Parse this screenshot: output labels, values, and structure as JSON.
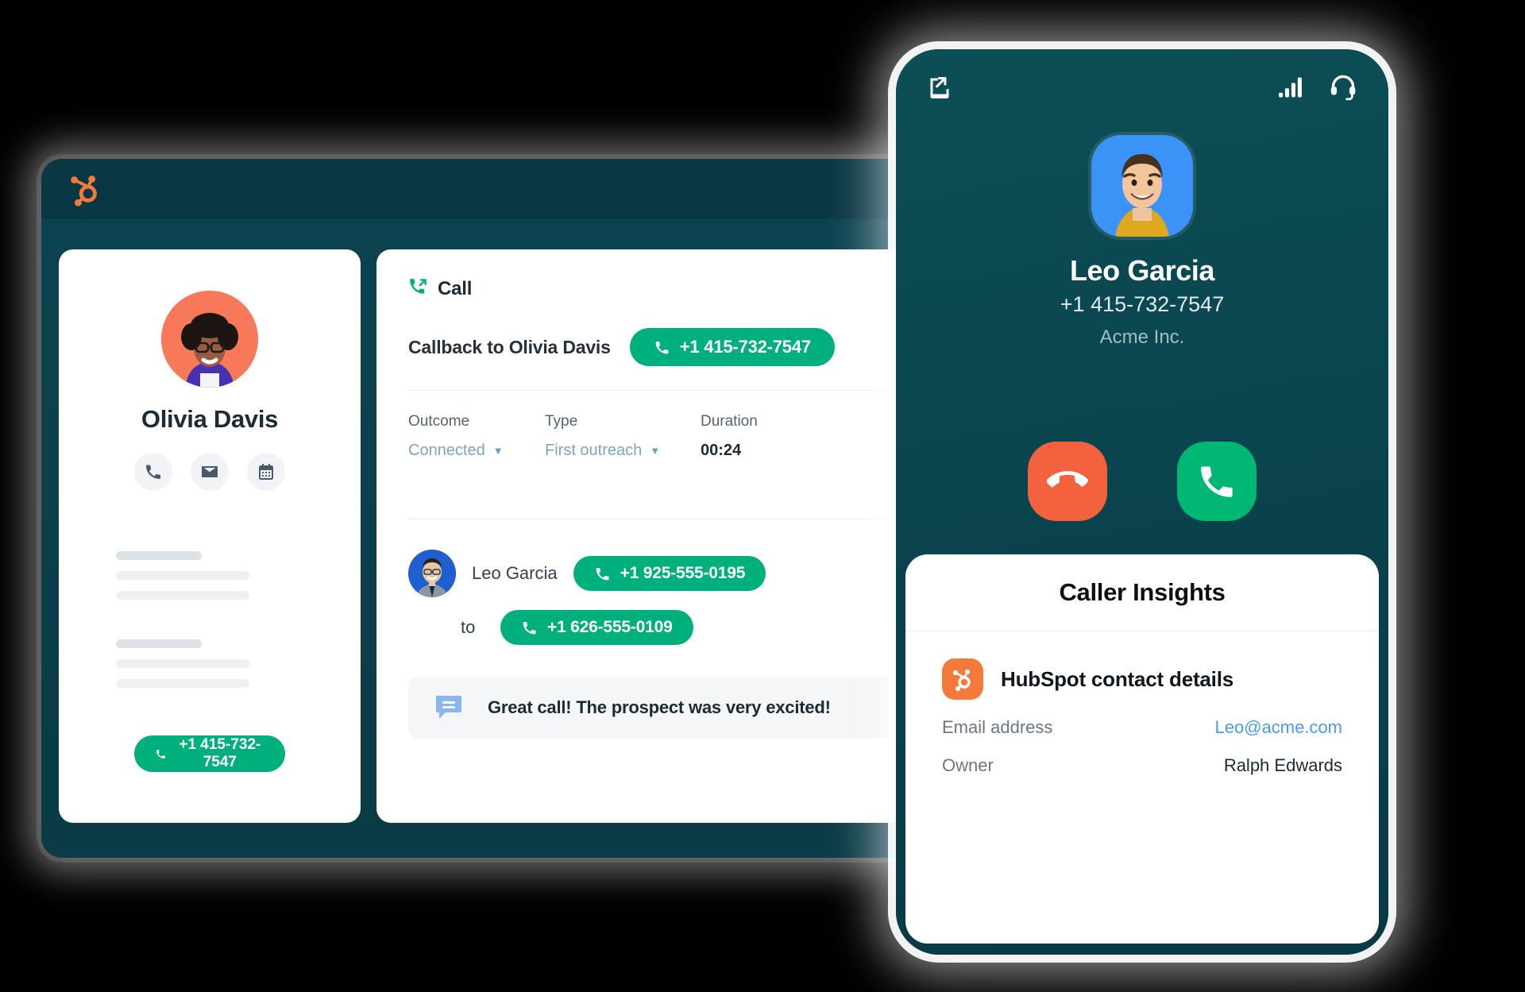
{
  "desktop": {
    "topbar": {
      "logo": "hubspot-sprocket-icon"
    },
    "contact_card": {
      "name": "Olivia Davis",
      "avatar_alt": "Olivia Davis avatar",
      "actions": [
        {
          "icon": "phone-icon",
          "name": "call"
        },
        {
          "icon": "email-icon",
          "name": "email"
        },
        {
          "icon": "calendar-icon",
          "name": "meeting"
        }
      ],
      "phone_button": "+1 415-732-7547"
    },
    "call_card": {
      "header": "Call",
      "header_icon": "outgoing-call-icon",
      "callback_label": "Callback to Olivia Davis",
      "callback_number": "+1 415-732-7547",
      "meta": [
        {
          "label": "Outcome",
          "value": "Connected",
          "dropdown": true
        },
        {
          "label": "Type",
          "value": "First outreach",
          "dropdown": true
        },
        {
          "label": "Duration",
          "value": "00:24",
          "dropdown": false
        }
      ],
      "participant": {
        "name": "Leo Garcia",
        "from_number": "+1 925-555-0195",
        "to_label": "to",
        "to_number": "+1 626-555-0109"
      },
      "note": {
        "icon": "comment-icon",
        "text": "Great call! The prospect was very excited!"
      }
    }
  },
  "phone": {
    "status_bar": {
      "minimize_icon": "minimize-icon",
      "signal_icon": "signal-bars-icon",
      "headset_icon": "headset-icon"
    },
    "caller": {
      "name": "Leo Garcia",
      "number": "+1 415-732-7547",
      "company": "Acme Inc."
    },
    "actions": {
      "decline": "decline-call",
      "accept": "accept-call"
    },
    "insights": {
      "title": "Caller Insights",
      "source_label": "HubSpot contact details",
      "source_icon": "hubspot-sprocket-icon",
      "details": [
        {
          "label": "Email address",
          "value": "Leo@acme.com",
          "link": true
        },
        {
          "label": "Owner",
          "value": "Ralph Edwards",
          "link": false
        }
      ]
    }
  },
  "colors": {
    "green": "#00b07c",
    "orange": "#f4793b",
    "dark_navy": "#0a3744",
    "teal": "#0a4650",
    "red": "#f4613f",
    "link_blue": "#4a9bf0"
  }
}
